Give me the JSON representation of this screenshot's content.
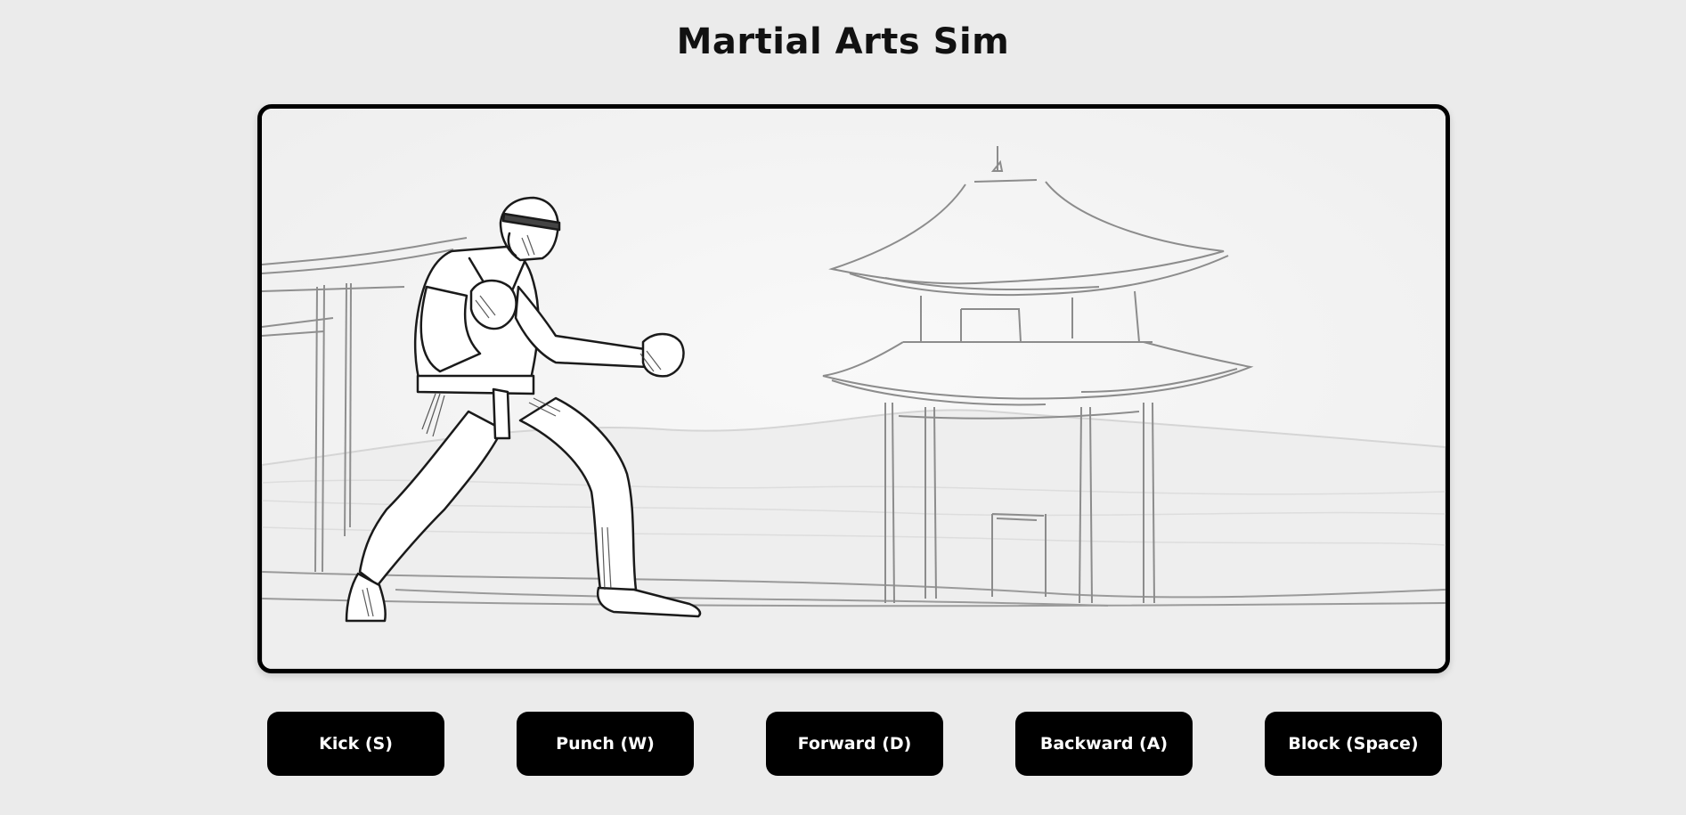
{
  "page": {
    "title": "Martial Arts Sim"
  },
  "scene": {
    "fighter": "martial-artist-fighter",
    "background": "pagoda-temple-sketch"
  },
  "controls": [
    {
      "label": "Kick (S)",
      "key": "S"
    },
    {
      "label": "Punch (W)",
      "key": "W"
    },
    {
      "label": "Forward (D)",
      "key": "D"
    },
    {
      "label": "Backward (A)",
      "key": "A"
    },
    {
      "label": "Block (Space)",
      "key": "Space"
    }
  ],
  "colors": {
    "background": "#ebebeb",
    "button": "#000000",
    "button_text": "#ffffff",
    "stage_border": "#000000"
  }
}
